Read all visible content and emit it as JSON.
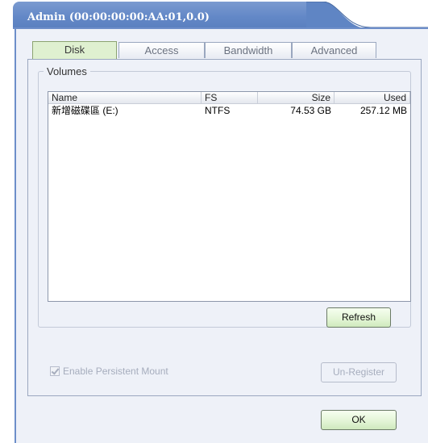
{
  "window": {
    "title": "Admin (00:00:00:00:AA:01,0.0)"
  },
  "tabs": [
    {
      "label": "Disk",
      "active": true
    },
    {
      "label": "Access",
      "active": false
    },
    {
      "label": "Bandwidth",
      "active": false
    },
    {
      "label": "Advanced",
      "active": false
    }
  ],
  "volumes": {
    "group_label": "Volumes",
    "columns": [
      "Name",
      "FS",
      "Size",
      "Used"
    ],
    "rows": [
      {
        "name": "新增磁碟區 (E:)",
        "fs": "NTFS",
        "size": "74.53 GB",
        "used": "257.12 MB"
      }
    ],
    "refresh_label": "Refresh"
  },
  "options": {
    "persistent_mount_label": "Enable Persistent Mount",
    "persistent_mount_checked": true,
    "persistent_mount_enabled": false,
    "unregister_label": "Un-Register",
    "unregister_enabled": false
  },
  "footer": {
    "ok_label": "OK"
  },
  "colors": {
    "title_bar": "#6388c7",
    "active_tab": "#dff0d0",
    "button_fill": "#e2f4d4",
    "panel_bg": "#eef1f8"
  },
  "icons": {
    "checkbox": "checkmark-icon"
  }
}
